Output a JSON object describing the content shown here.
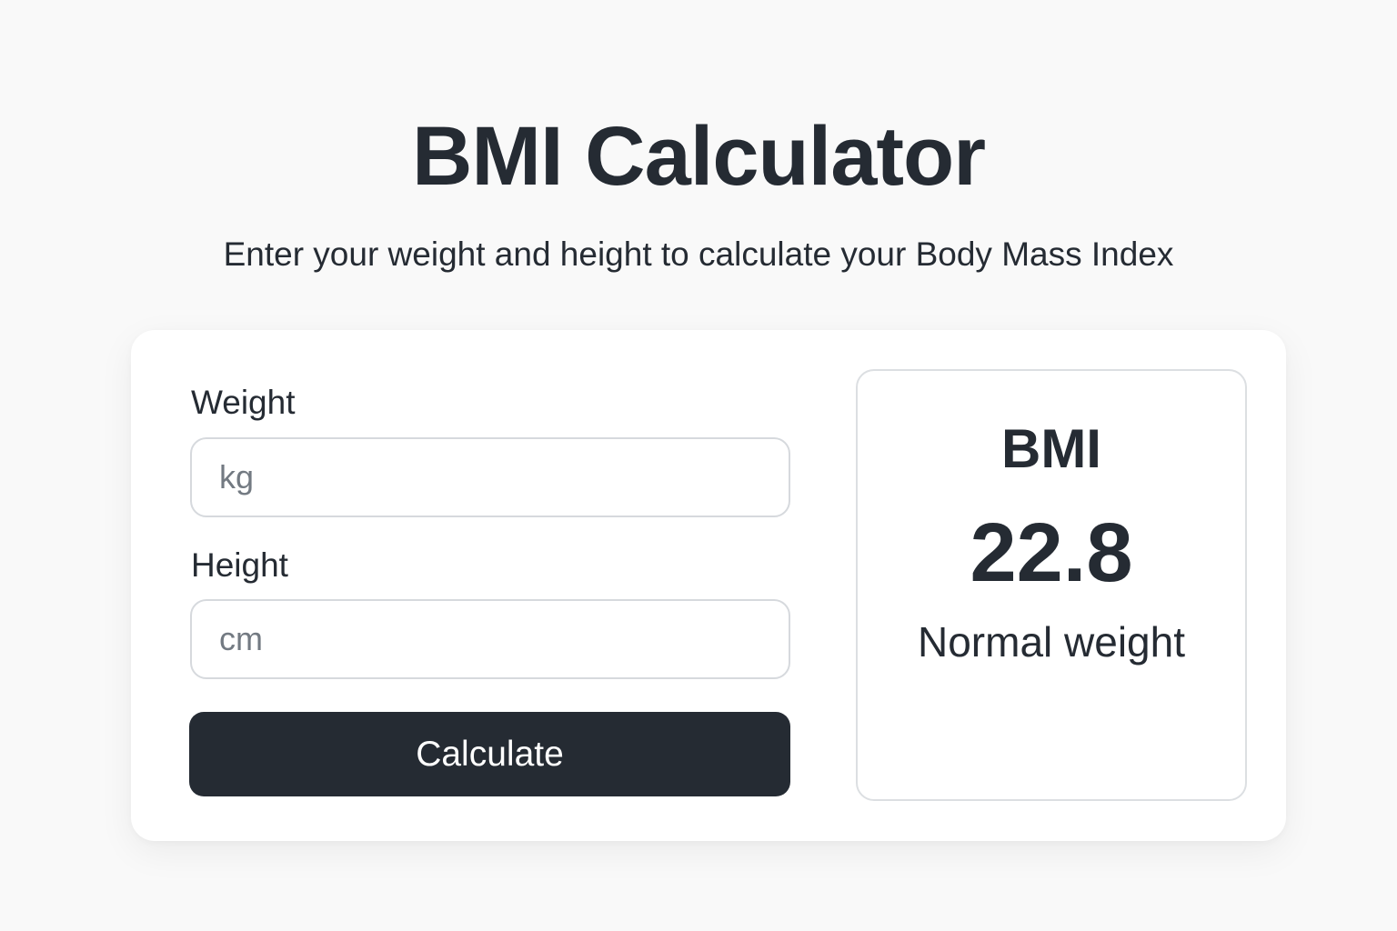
{
  "header": {
    "title": "BMI Calculator",
    "subtitle": "Enter your weight and height to calculate your Body Mass Index"
  },
  "form": {
    "weight": {
      "label": "Weight",
      "value": "",
      "placeholder": "kg"
    },
    "height": {
      "label": "Height",
      "value": "",
      "placeholder": "cm"
    },
    "submit_label": "Calculate"
  },
  "result": {
    "label": "BMI",
    "value": "22.8",
    "category": "Normal weight"
  },
  "colors": {
    "background": "#f9f9f9",
    "text": "#252b33",
    "button": "#252b33",
    "button_text": "#ffffff",
    "placeholder": "#737a82",
    "border": "#d6d9dd"
  }
}
